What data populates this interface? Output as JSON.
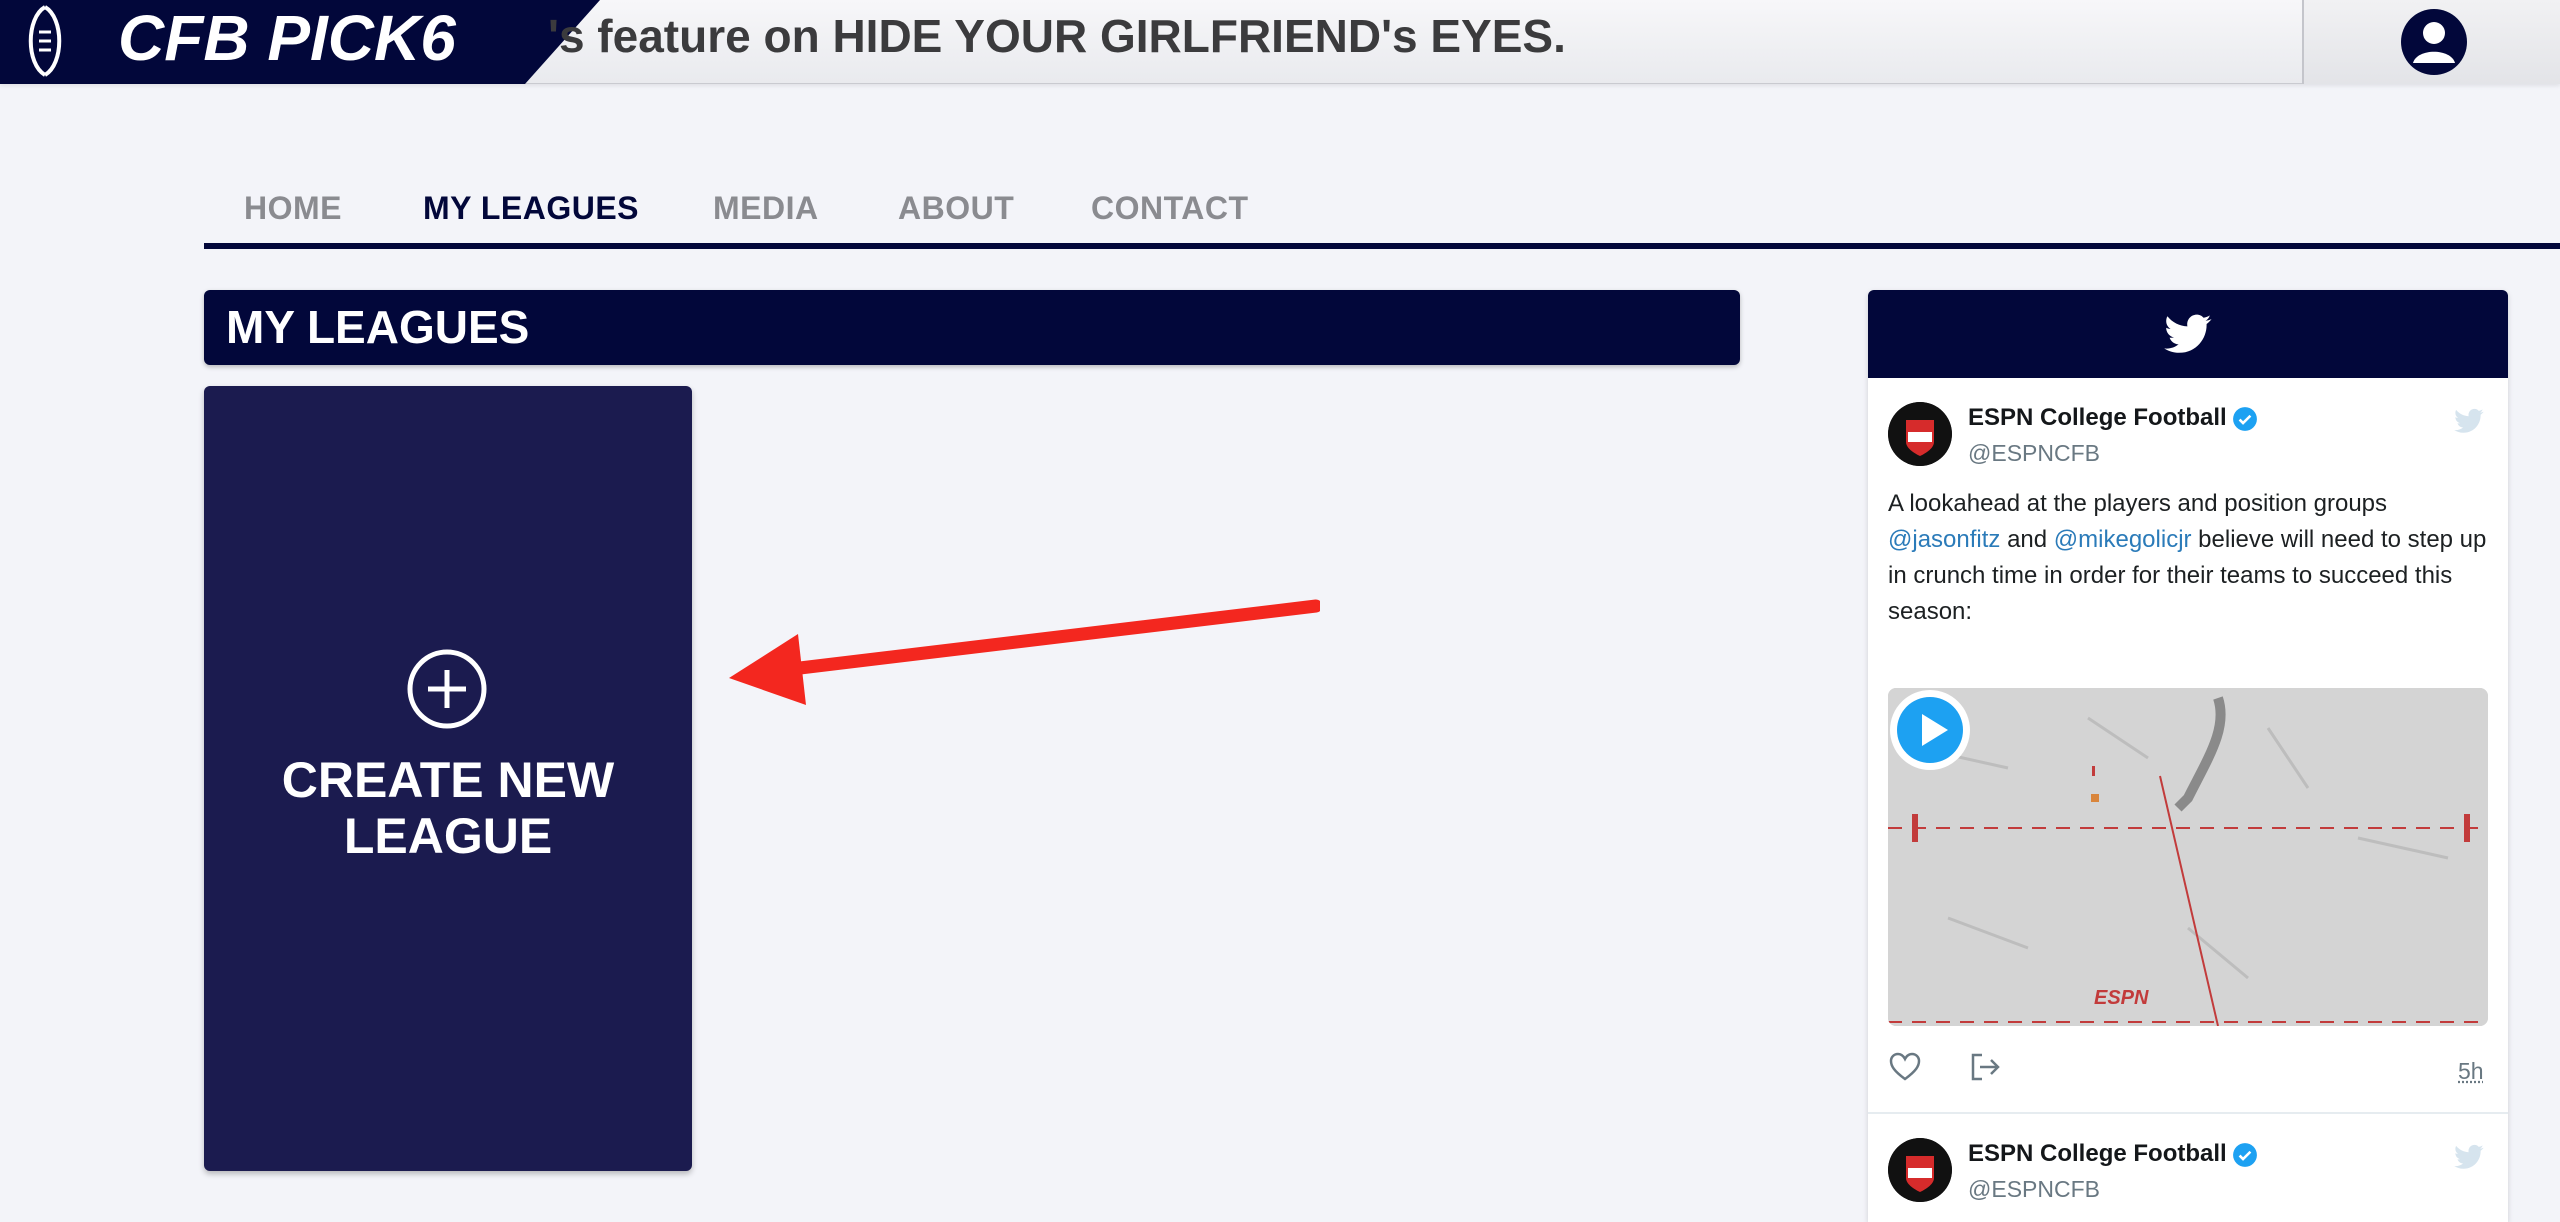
{
  "header": {
    "brand_name": "CFB PICK6",
    "ticker_text": "'s feature on HIDE YOUR GIRLFRIEND's EYES.",
    "brand_icon": "football-icon",
    "profile_icon": "user-avatar-icon",
    "colors": {
      "navy": "#02073a",
      "card": "#1b1b4f"
    }
  },
  "nav": {
    "items": [
      {
        "label": "HOME",
        "active": false
      },
      {
        "label": "MY LEAGUES",
        "active": true
      },
      {
        "label": "MEDIA",
        "active": false
      },
      {
        "label": "ABOUT",
        "active": false
      },
      {
        "label": "CONTACT",
        "active": false
      }
    ]
  },
  "main": {
    "section_title": "MY LEAGUES",
    "create_card": {
      "icon": "plus-circle-icon",
      "label": "CREATE NEW LEAGUE"
    },
    "annotation_color": "#f3271f"
  },
  "twitter": {
    "header_icon": "twitter-bird-icon",
    "tweets": [
      {
        "author": "ESPN College Football",
        "handle": "@ESPNCFB",
        "text_part1": "A lookahead at the players and position groups ",
        "mention1": "@jasonfitz",
        "text_part2": " and ",
        "mention2": "@mikegolicjr",
        "text_part3": " believe will need to step up in crunch time in order for their teams to succeed this season:",
        "timestamp": "5h",
        "media_watermark": "ESPN"
      },
      {
        "author": "ESPN College Football",
        "handle": "@ESPNCFB"
      }
    ],
    "link_color": "#2b7bb9",
    "verified_color": "#1da1f2"
  }
}
